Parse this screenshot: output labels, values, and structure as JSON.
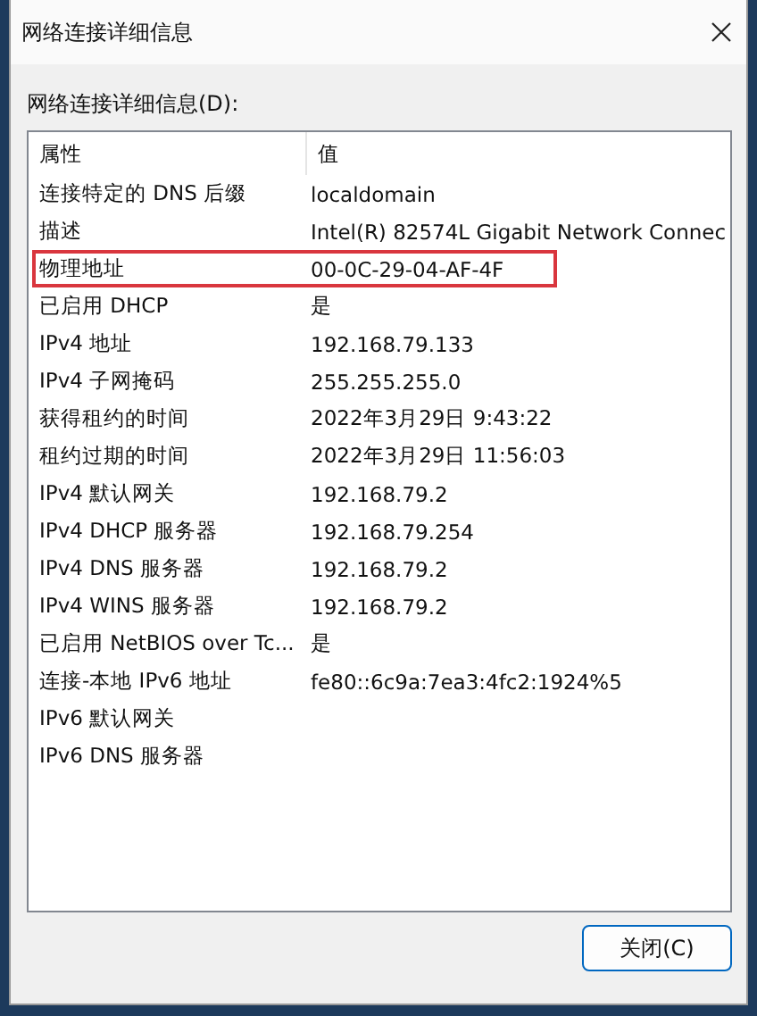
{
  "window": {
    "title": "网络连接详细信息"
  },
  "list_label": "网络连接详细信息(D):",
  "table": {
    "columns": [
      "属性",
      "值"
    ],
    "rows": [
      {
        "property": "连接特定的 DNS 后缀",
        "value": "localdomain",
        "highlighted": false
      },
      {
        "property": "描述",
        "value": "Intel(R) 82574L Gigabit Network Connec",
        "highlighted": false
      },
      {
        "property": "物理地址",
        "value": "00-0C-29-04-AF-4F",
        "highlighted": true
      },
      {
        "property": "已启用 DHCP",
        "value": "是",
        "highlighted": false
      },
      {
        "property": "IPv4 地址",
        "value": "192.168.79.133",
        "highlighted": false
      },
      {
        "property": "IPv4 子网掩码",
        "value": "255.255.255.0",
        "highlighted": false
      },
      {
        "property": "获得租约的时间",
        "value": "2022年3月29日 9:43:22",
        "highlighted": false
      },
      {
        "property": "租约过期的时间",
        "value": "2022年3月29日 11:56:03",
        "highlighted": false
      },
      {
        "property": "IPv4 默认网关",
        "value": "192.168.79.2",
        "highlighted": false
      },
      {
        "property": "IPv4 DHCP 服务器",
        "value": "192.168.79.254",
        "highlighted": false
      },
      {
        "property": "IPv4 DNS 服务器",
        "value": "192.168.79.2",
        "highlighted": false
      },
      {
        "property": "IPv4 WINS 服务器",
        "value": "192.168.79.2",
        "highlighted": false
      },
      {
        "property": "已启用 NetBIOS over Tc...",
        "value": "是",
        "highlighted": false
      },
      {
        "property": "连接-本地 IPv6 地址",
        "value": "fe80::6c9a:7ea3:4fc2:1924%5",
        "highlighted": false
      },
      {
        "property": "IPv6 默认网关",
        "value": "",
        "highlighted": false
      },
      {
        "property": "IPv6 DNS 服务器",
        "value": "",
        "highlighted": false
      }
    ]
  },
  "buttons": [
    "关闭(C)"
  ]
}
